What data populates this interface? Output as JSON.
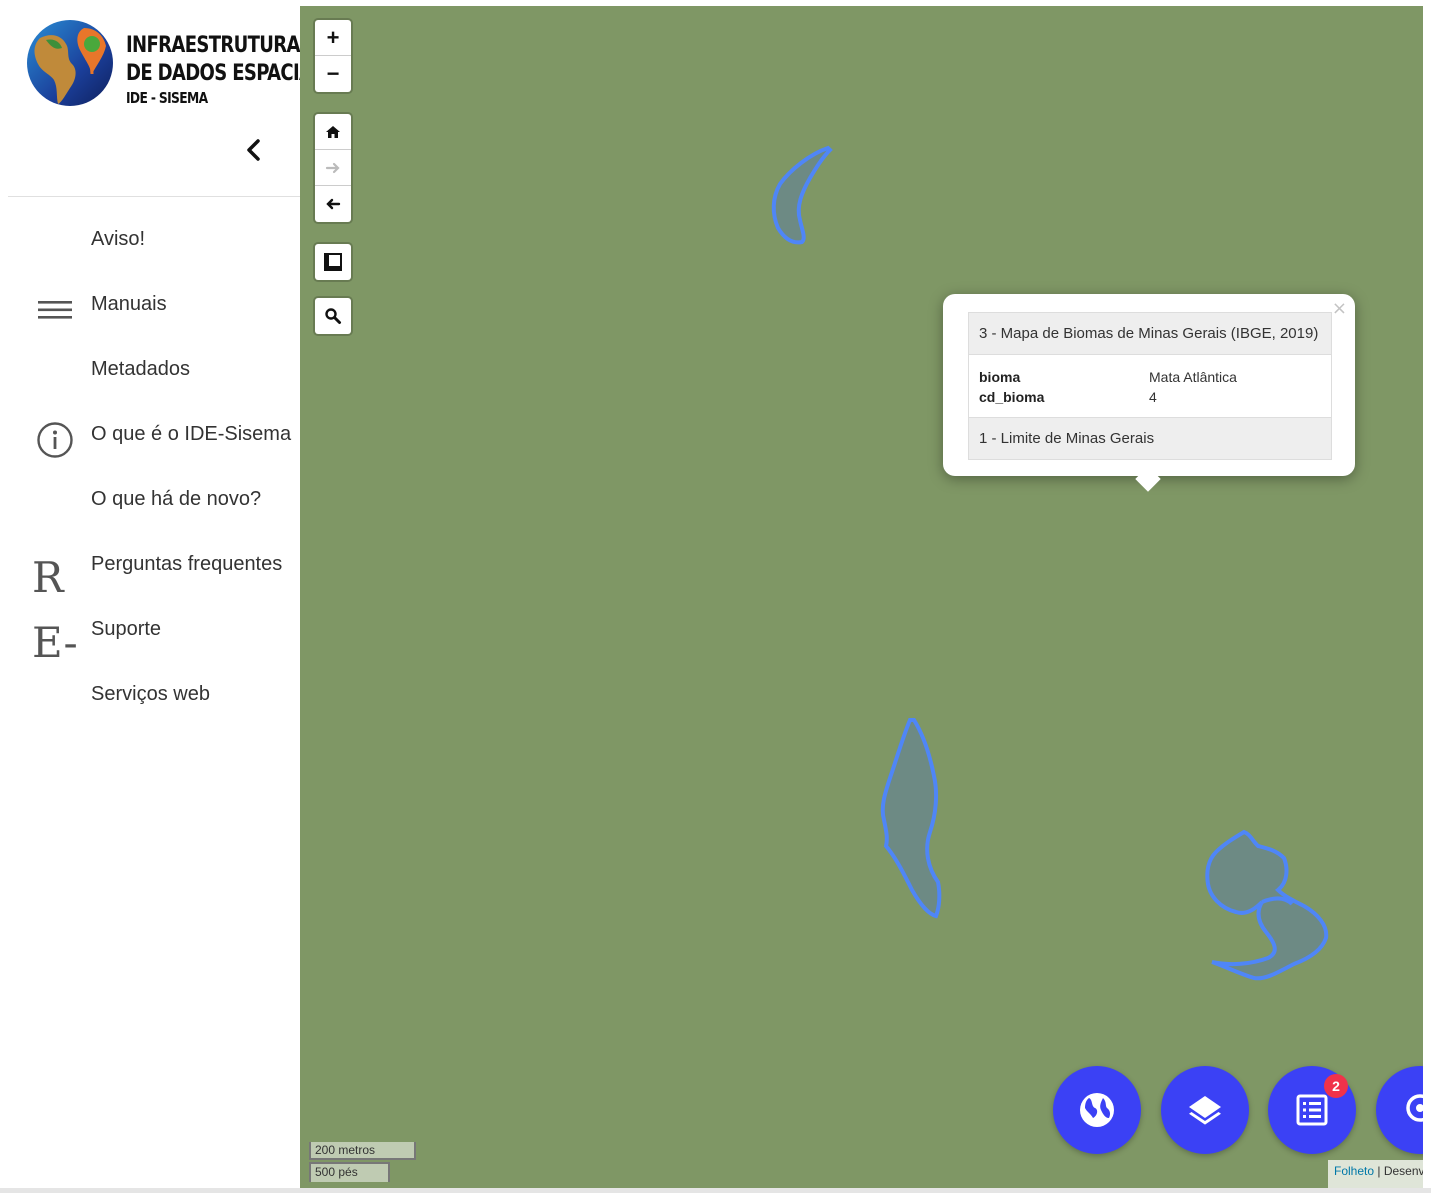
{
  "logo": {
    "line1": "INFRAESTRUTURA",
    "line2": "DE DADOS ESPACIAIS",
    "line3": "IDE - SISEMA"
  },
  "sidebar": {
    "items": [
      {
        "label": "Aviso!",
        "icon": ""
      },
      {
        "label": "Manuais",
        "icon": "menu-icon"
      },
      {
        "label": "Metadados",
        "icon": ""
      },
      {
        "label": "O que é o IDE-Sisema",
        "icon": "info-icon"
      },
      {
        "label": "O que há de novo?",
        "icon": ""
      },
      {
        "label": "Perguntas frequentes",
        "icon": "r-glyph"
      },
      {
        "label": "Suporte",
        "icon": "e-glyph"
      },
      {
        "label": "Serviços web",
        "icon": ""
      }
    ],
    "glyph_r": "R",
    "glyph_e": "E-"
  },
  "map_controls": {
    "zoom_in": "+",
    "zoom_out": "−"
  },
  "popup": {
    "close": "×",
    "layer_title": "3 - Mapa de Biomas de Minas Gerais (IBGE, 2019)",
    "attributes": [
      {
        "key": "bioma",
        "value": "Mata Atlântica"
      },
      {
        "key": "cd_bioma",
        "value": "4"
      }
    ],
    "layer2_title": "1 - Limite de Minas Gerais"
  },
  "fab": {
    "badge_count": "2",
    "color": "#3b41f5"
  },
  "scale": {
    "metric": "200 metros",
    "imperial": "500 pés"
  },
  "attribution": {
    "link": "Folheto",
    "text": " | Desenvolvido"
  },
  "colors": {
    "map_background": "#7f9765",
    "polygon_stroke": "#4f86f7",
    "polygon_fill": "#6d8a84",
    "accent": "#3b41f5",
    "badge": "#f0324a"
  }
}
